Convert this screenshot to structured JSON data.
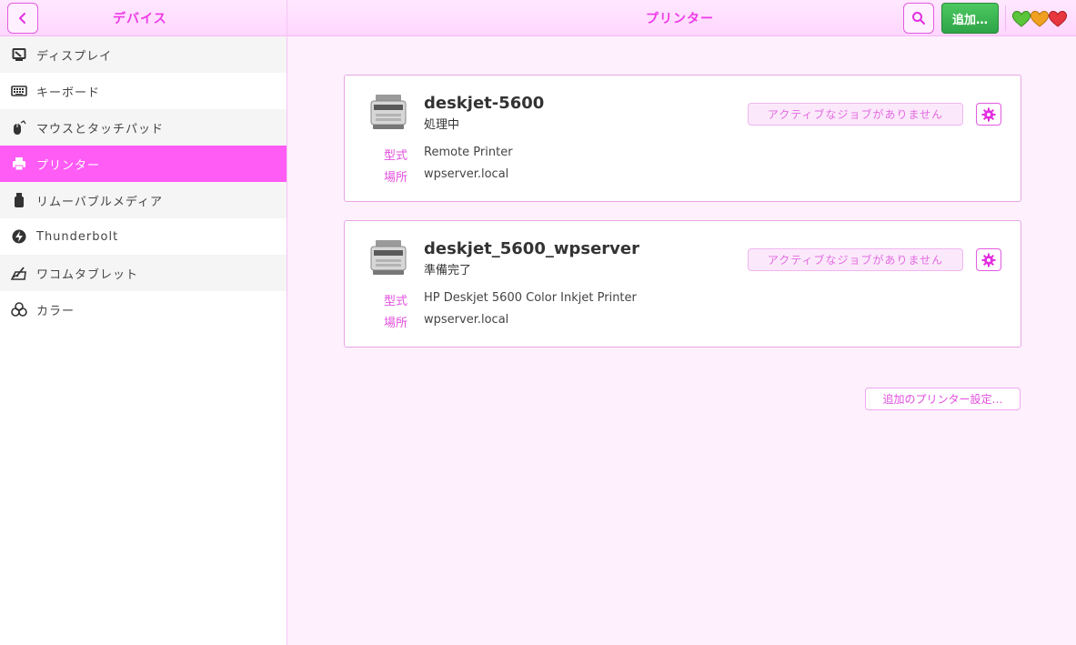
{
  "sidebar_header": {
    "title": "デバイス",
    "back_icon": "chevron-left-icon"
  },
  "main_header": {
    "title": "プリンター",
    "search_icon": "search-icon",
    "add_label": "追加…",
    "status_hearts": [
      "#5ac43a",
      "#f0a020",
      "#e8363e"
    ]
  },
  "sidebar": {
    "items": [
      {
        "label": "ディスプレイ",
        "icon": "display-icon"
      },
      {
        "label": "キーボード",
        "icon": "keyboard-icon"
      },
      {
        "label": "マウスとタッチパッド",
        "icon": "mouse-icon"
      },
      {
        "label": "プリンター",
        "icon": "printer-icon",
        "active": true
      },
      {
        "label": "リムーバブルメディア",
        "icon": "usb-drive-icon"
      },
      {
        "label": "Thunderbolt",
        "icon": "thunderbolt-icon"
      },
      {
        "label": "ワコムタブレット",
        "icon": "tablet-icon"
      },
      {
        "label": "カラー",
        "icon": "color-icon"
      }
    ]
  },
  "printers": [
    {
      "name": "deskjet-5600",
      "status": "処理中",
      "jobs_label": "アクティブなジョブがありません",
      "model_label": "型式",
      "model": "Remote Printer",
      "location_label": "場所",
      "location": "wpserver.local"
    },
    {
      "name": "deskjet_5600_wpserver",
      "status": "準備完了",
      "jobs_label": "アクティブなジョブがありません",
      "model_label": "型式",
      "model": "HP Deskjet 5600 Color Inkjet Printer",
      "location_label": "場所",
      "location": "wpserver.local"
    }
  ],
  "extra_settings_label": "追加のプリンター設定…",
  "colors": {
    "accent": "#ff5cf5",
    "accent_dark": "#e25be0",
    "add_button": "#3bb553"
  }
}
